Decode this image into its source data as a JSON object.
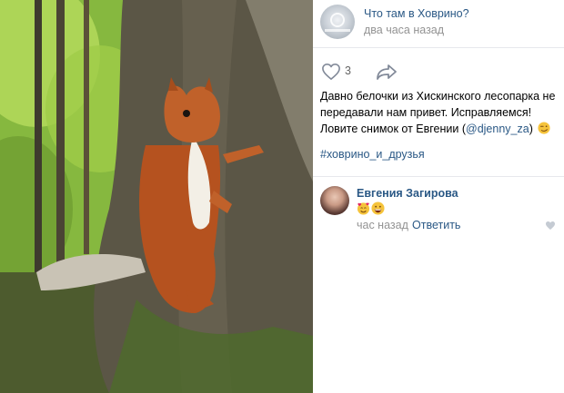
{
  "header": {
    "group_name": "Что там в Ховрино?",
    "post_time": "два часа назад"
  },
  "actions": {
    "like_count": "3"
  },
  "post": {
    "text_line": "Давно белочки из Хискинского лесопарка не передавали нам привет. Исправляемся! Ловите снимок от Евгении (",
    "mention": "@djenny_za",
    "text_after": ")",
    "hashtag": "#ховрино_и_друзья"
  },
  "comment": {
    "author": "Евгения Загирова",
    "time": "час назад",
    "reply_label": "Ответить"
  },
  "colors": {
    "link": "#2a5885",
    "muted": "#939393",
    "divider": "#e7e8ec"
  },
  "icons": {
    "like": "heart-outline-icon",
    "share": "share-arrow-icon",
    "comment_like": "heart-small-icon",
    "emoji_1": "smiling-face-with-hearts-emoji",
    "emoji_2": "grinning-face-emoji",
    "emoji_wink": "smirk-face-emoji"
  }
}
